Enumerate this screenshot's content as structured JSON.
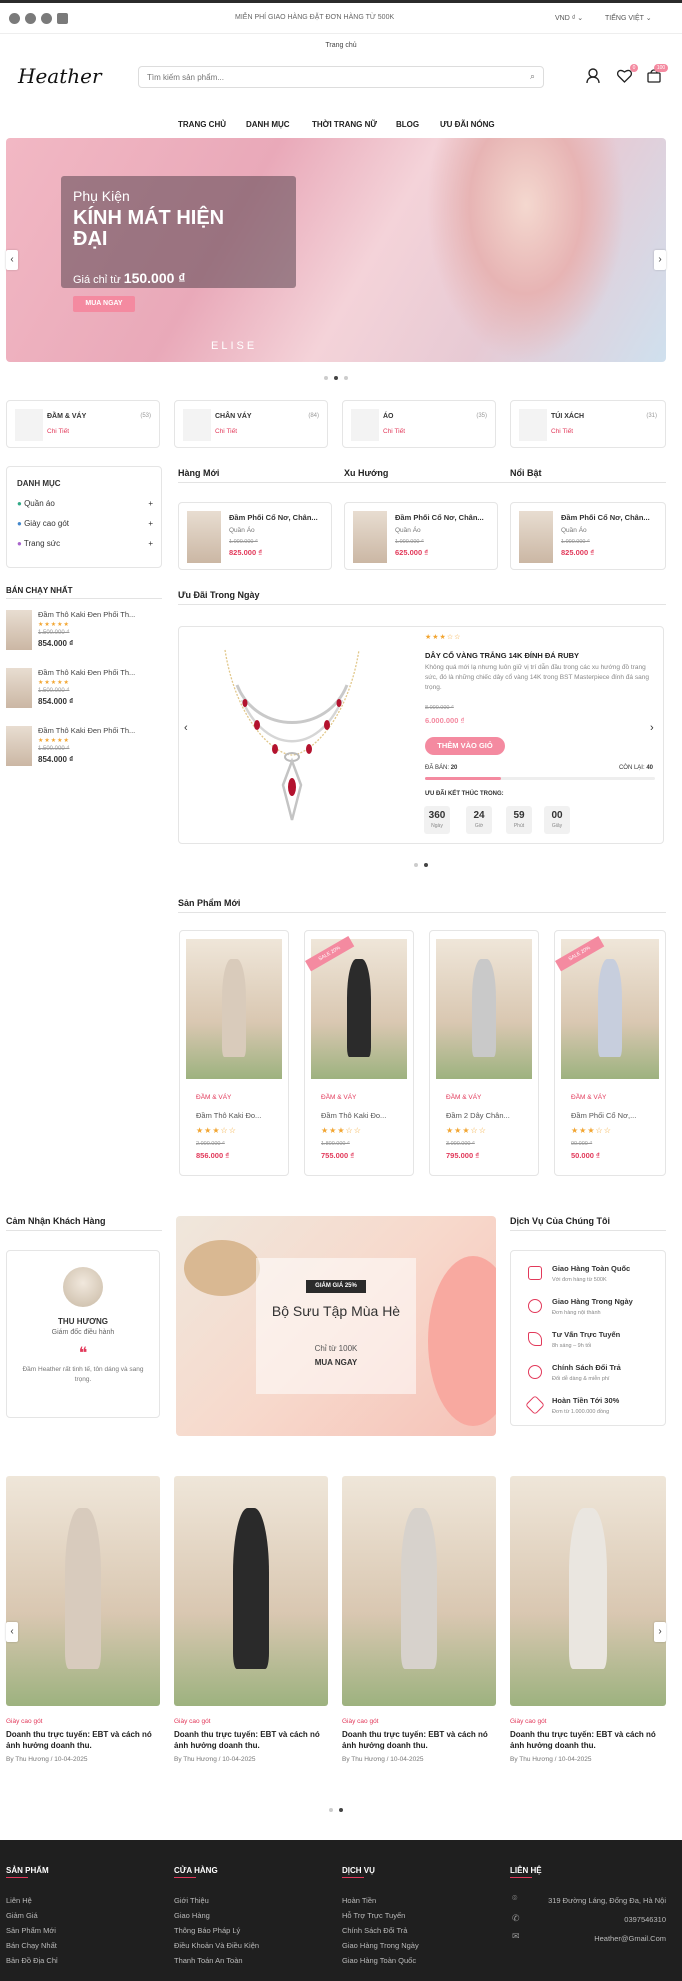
{
  "topbar": {
    "promo": "MIỄN PHÍ GIAO HÀNG ĐẶT ĐƠN HÀNG TỪ 500K",
    "currency": "VND ₫",
    "language": "TIẾNG VIỆT",
    "social": [
      "facebook-icon",
      "twitter-icon",
      "instagram-icon",
      "linkedin-icon"
    ]
  },
  "breadcrumb": "Trang chủ",
  "header": {
    "logo": "Heather",
    "search_placeholder": "Tìm kiếm sản phẩm...",
    "wishlist_count": "0",
    "cart_count": "100"
  },
  "nav": [
    "TRANG CHỦ",
    "DANH MỤC",
    "THỜI TRANG NỮ",
    "BLOG",
    "ƯU ĐÃI NÓNG"
  ],
  "hero": {
    "kicker": "Phụ Kiện",
    "title_line1": "KÍNH MÁT HIỆN",
    "title_line2": "ĐẠI",
    "price_prefix": "Giá chỉ từ",
    "price": "150.000 ₫",
    "button": "MUA NGAY",
    "brand": "ELISE"
  },
  "categories": [
    {
      "name": "ĐẦM & VÁY",
      "count": "(53)",
      "link": "Chi Tiết"
    },
    {
      "name": "CHÂN VÁY",
      "count": "(84)",
      "link": "Chi Tiết"
    },
    {
      "name": "ÁO",
      "count": "(35)",
      "link": "Chi Tiết"
    },
    {
      "name": "TÚI XÁCH",
      "count": "(31)",
      "link": "Chi Tiết"
    }
  ],
  "sidebar": {
    "title": "DANH MỤC",
    "items": [
      "Quần áo",
      "Giày cao gót",
      "Trang sức"
    ],
    "best_title": "BÁN CHẠY NHẤT",
    "best": [
      {
        "name": "Đầm Thô Kaki Đen Phối Th...",
        "old": "1.500.000 ₫",
        "price": "854.000 ₫"
      },
      {
        "name": "Đầm Thô Kaki Đen Phối Th...",
        "old": "1.500.000 ₫",
        "price": "854.000 ₫"
      },
      {
        "name": "Đầm Thô Kaki Đen Phối Th...",
        "old": "1.500.000 ₫",
        "price": "854.000 ₫"
      }
    ]
  },
  "tabs": [
    {
      "title": "Hàng Mới",
      "name": "Đầm Phối Cổ Nơ, Chân...",
      "cat": "Quần Áo",
      "old": "1.000.000 ₫",
      "price": "825.000 ₫"
    },
    {
      "title": "Xu Hướng",
      "name": "Đầm Phối Cổ Nơ, Chân...",
      "cat": "Quần Áo",
      "old": "1.000.000 ₫",
      "price": "625.000 ₫"
    },
    {
      "title": "Nổi Bật",
      "name": "Đầm Phối Cổ Nơ, Chân...",
      "cat": "Quần Áo",
      "old": "1.000.000 ₫",
      "price": "825.000 ₫"
    }
  ],
  "deal": {
    "section": "Ưu Đãi Trong Ngày",
    "name": "DÂY CỔ VÀNG TRẮNG 14K ĐÍNH ĐÁ RUBY",
    "desc": "Không quá mới lạ nhưng luôn giữ vị trí dẫn đầu trong các xu hướng đồ trang sức, đó là những chiếc dây cổ vàng 14K trong BST Masterpiece đính đá sang trọng.",
    "old": "8.000.000 ₫",
    "price": "6.000.000 ₫",
    "button": "THÊM VÀO GIỎ",
    "sold_label": "ĐÃ BÁN:",
    "sold": "20",
    "left_label": "CÒN LẠI:",
    "left": "40",
    "sold_fraction": 0.33,
    "ends": "ƯU ĐÃI KẾT THÚC TRONG:",
    "timer": [
      {
        "v": "360",
        "u": "Ngày"
      },
      {
        "v": "24",
        "u": "Giờ"
      },
      {
        "v": "59",
        "u": "Phút"
      },
      {
        "v": "00",
        "u": "Giây"
      }
    ]
  },
  "new_products": {
    "title": "Sản Phẩm Mới",
    "badge": "SALE 20%",
    "items": [
      {
        "cat": "ĐẦM & VÁY",
        "name": "Đầm Thô Kaki Đo...",
        "old": "2.000.000 ₫",
        "price": "856.000 ₫",
        "sale": false
      },
      {
        "cat": "ĐẦM & VÁY",
        "name": "Đầm Thô Kaki Đo...",
        "old": "1.800.000 ₫",
        "price": "755.000 ₫",
        "sale": true
      },
      {
        "cat": "ĐẦM & VÁY",
        "name": "Đầm 2 Dây Chân...",
        "old": "3.000.000 ₫",
        "price": "795.000 ₫",
        "sale": false
      },
      {
        "cat": "ĐẦM & VÁY",
        "name": "Đầm Phối Cổ Nơ,...",
        "old": "90.000 ₫",
        "price": "50.000 ₫",
        "sale": true
      }
    ]
  },
  "testimonial": {
    "title": "Cảm Nhận Khách Hàng",
    "name": "THU HƯƠNG",
    "role": "Giám đốc điều hành",
    "quote": "Đầm Heather rất tinh tế, tôn dáng và sang trọng."
  },
  "promo": {
    "badge": "GIẢM GIÁ 25%",
    "title": "Bộ Sưu Tập Mùa Hè",
    "price": "Chỉ từ 100K",
    "button": "MUA NGAY"
  },
  "services": {
    "title": "Dịch Vụ Của Chúng Tôi",
    "items": [
      {
        "t": "Giao Hàng Toàn Quốc",
        "s": "Với đơn hàng từ 500K"
      },
      {
        "t": "Giao Hàng Trong Ngày",
        "s": "Đơn hàng nội thành"
      },
      {
        "t": "Tư Vấn Trực Tuyến",
        "s": "8h sáng – 9h tối"
      },
      {
        "t": "Chính Sách Đổi Trả",
        "s": "Đổi dễ dàng & miễn phí"
      },
      {
        "t": "Hoàn Tiền Tới 30%",
        "s": "Đơn từ 1.000.000 đồng"
      }
    ]
  },
  "blog": [
    {
      "cat": "Giày cao gót",
      "title": "Doanh thu trực tuyến: EBT và cách nó ảnh hưởng doanh thu.",
      "meta": "By Thu Hương / 10-04-2025"
    },
    {
      "cat": "Giày cao gót",
      "title": "Doanh thu trực tuyến: EBT và cách nó ảnh hưởng doanh thu.",
      "meta": "By Thu Hương / 10-04-2025"
    },
    {
      "cat": "Giày cao gót",
      "title": "Doanh thu trực tuyến: EBT và cách nó ảnh hưởng doanh thu.",
      "meta": "By Thu Hương / 10-04-2025"
    },
    {
      "cat": "Giày cao gót",
      "title": "Doanh thu trực tuyến: EBT và cách nó ảnh hưởng doanh thu.",
      "meta": "By Thu Hương / 10-04-2025"
    }
  ],
  "footer": {
    "cols": [
      {
        "h": "SẢN PHẨM",
        "l": [
          "Liên Hệ",
          "Giảm Giá",
          "Sản Phẩm Mới",
          "Bán Chạy Nhất",
          "Bản Đồ Địa Chỉ"
        ]
      },
      {
        "h": "CỬA HÀNG",
        "l": [
          "Giới Thiệu",
          "Giao Hàng",
          "Thông Báo Pháp Lý",
          "Điều Khoản Và Điều Kiện",
          "Thanh Toán An Toàn"
        ]
      },
      {
        "h": "DỊCH VỤ",
        "l": [
          "Hoàn Tiền",
          "Hỗ Trợ Trực Tuyến",
          "Chính Sách Đổi Trả",
          "Giao Hàng Trong Ngày",
          "Giao Hàng Toàn Quốc"
        ]
      }
    ],
    "contact": {
      "h": "LIÊN HỆ",
      "address": "319 Đường Láng, Đống Đa, Hà Nội",
      "phone": "0397546310",
      "email": "Heather@Gmail.Com"
    }
  },
  "colors": {
    "accent": "#e2395a",
    "pink": "#f48aa0",
    "dark": "#1f1f1f"
  }
}
